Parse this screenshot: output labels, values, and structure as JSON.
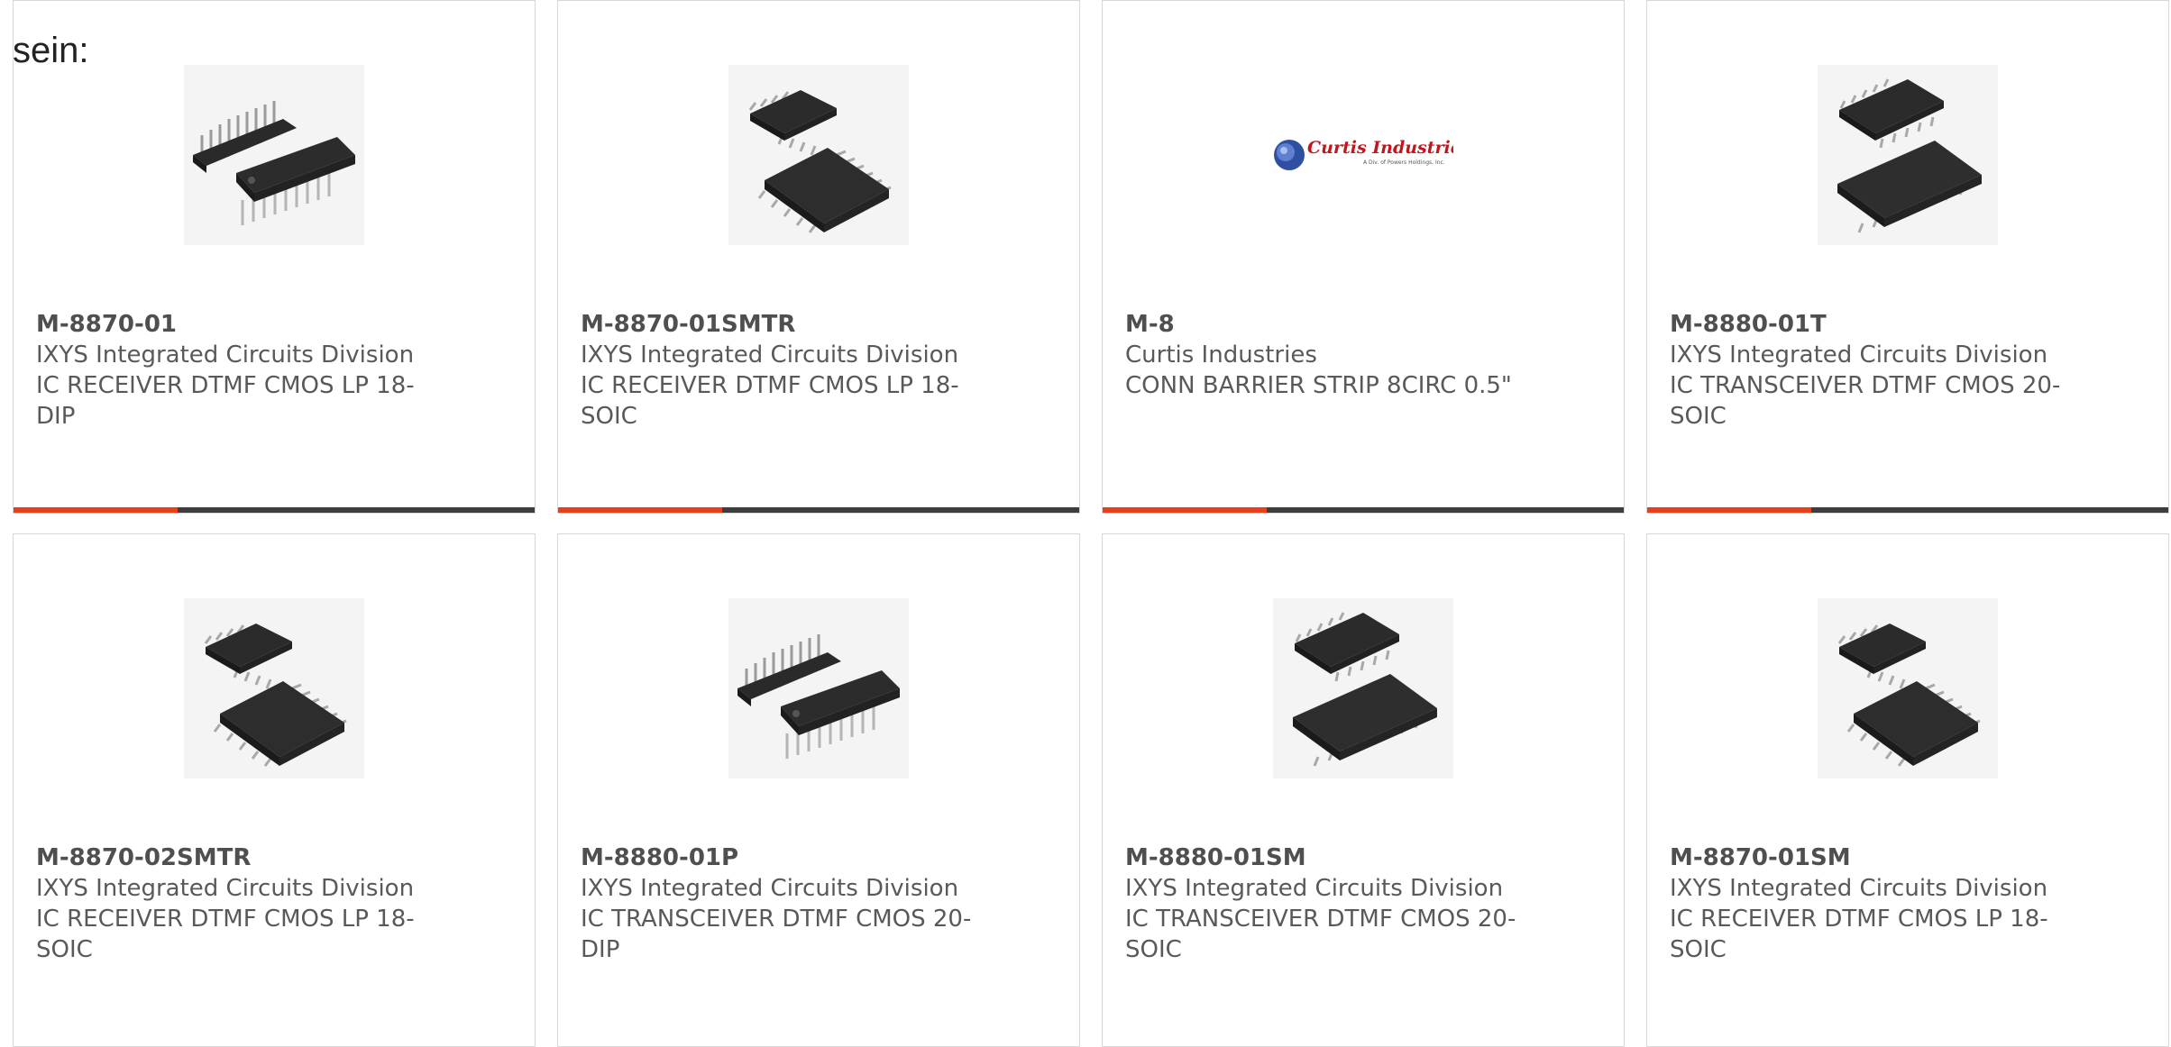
{
  "intro_text": "sein:",
  "colors": {
    "accent": "#e8401c",
    "bar": "#3d3d3d",
    "text": "#595959",
    "border": "#d8d8d8"
  },
  "products": [
    {
      "part_number": "M-8870-01",
      "manufacturer": "IXYS Integrated Circuits Division",
      "description": "IC RECEIVER DTMF CMOS LP 18-DIP",
      "image": "dip-chip-icon"
    },
    {
      "part_number": "M-8870-01SMTR",
      "manufacturer": "IXYS Integrated Circuits Division",
      "description": "IC RECEIVER DTMF CMOS LP 18-SOIC",
      "image": "soic-chip-icon"
    },
    {
      "part_number": "M-8",
      "manufacturer": "Curtis Industries",
      "description": "CONN BARRIER STRIP 8CIRC 0.5\"",
      "image": "curtis-industries-logo"
    },
    {
      "part_number": "M-8880-01T",
      "manufacturer": "IXYS Integrated Circuits Division",
      "description": "IC TRANSCEIVER DTMF CMOS 20-SOIC",
      "image": "soic-chip-icon"
    },
    {
      "part_number": "M-8870-02SMTR",
      "manufacturer": "IXYS Integrated Circuits Division",
      "description": "IC RECEIVER DTMF CMOS LP 18-SOIC",
      "image": "soic-chip-icon"
    },
    {
      "part_number": "M-8880-01P",
      "manufacturer": "IXYS Integrated Circuits Division",
      "description": "IC TRANSCEIVER DTMF CMOS 20-DIP",
      "image": "dip-chip-icon"
    },
    {
      "part_number": "M-8880-01SM",
      "manufacturer": "IXYS Integrated Circuits Division",
      "description": "IC TRANSCEIVER DTMF CMOS 20-SOIC",
      "image": "soic-chip-icon"
    },
    {
      "part_number": "M-8870-01SM",
      "manufacturer": "IXYS Integrated Circuits Division",
      "description": "IC RECEIVER DTMF CMOS LP 18-SOIC",
      "image": "soic-chip-icon"
    }
  ],
  "logo": {
    "title": "Curtis Industries",
    "subtitle": "A Div. of Powers Holdings, Inc."
  }
}
